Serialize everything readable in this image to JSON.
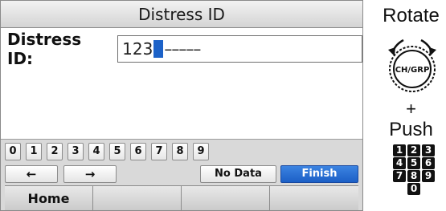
{
  "screen": {
    "title": "Distress ID",
    "entry": {
      "label": "Distress ID:",
      "typed": "123",
      "remaining": "–––––"
    },
    "keypad": {
      "digits": [
        "0",
        "1",
        "2",
        "3",
        "4",
        "5",
        "6",
        "7",
        "8",
        "9"
      ],
      "left_arrow": "←",
      "right_arrow": "→",
      "no_data": "No Data",
      "finish": "Finish"
    },
    "bottom_menu": [
      "Home",
      "",
      "",
      ""
    ]
  },
  "instructions": {
    "rotate": "Rotate",
    "knob_label": "CH/GRP",
    "plus": "+",
    "push": "Push",
    "numpad_rows": [
      [
        "1",
        "2",
        "3"
      ],
      [
        "4",
        "5",
        "6"
      ],
      [
        "7",
        "8",
        "9"
      ],
      [
        "0"
      ]
    ]
  },
  "colors": {
    "accent": "#1c62c8",
    "finish_button": "#2a6fd6",
    "keypad_background": "#d9d9d9"
  }
}
